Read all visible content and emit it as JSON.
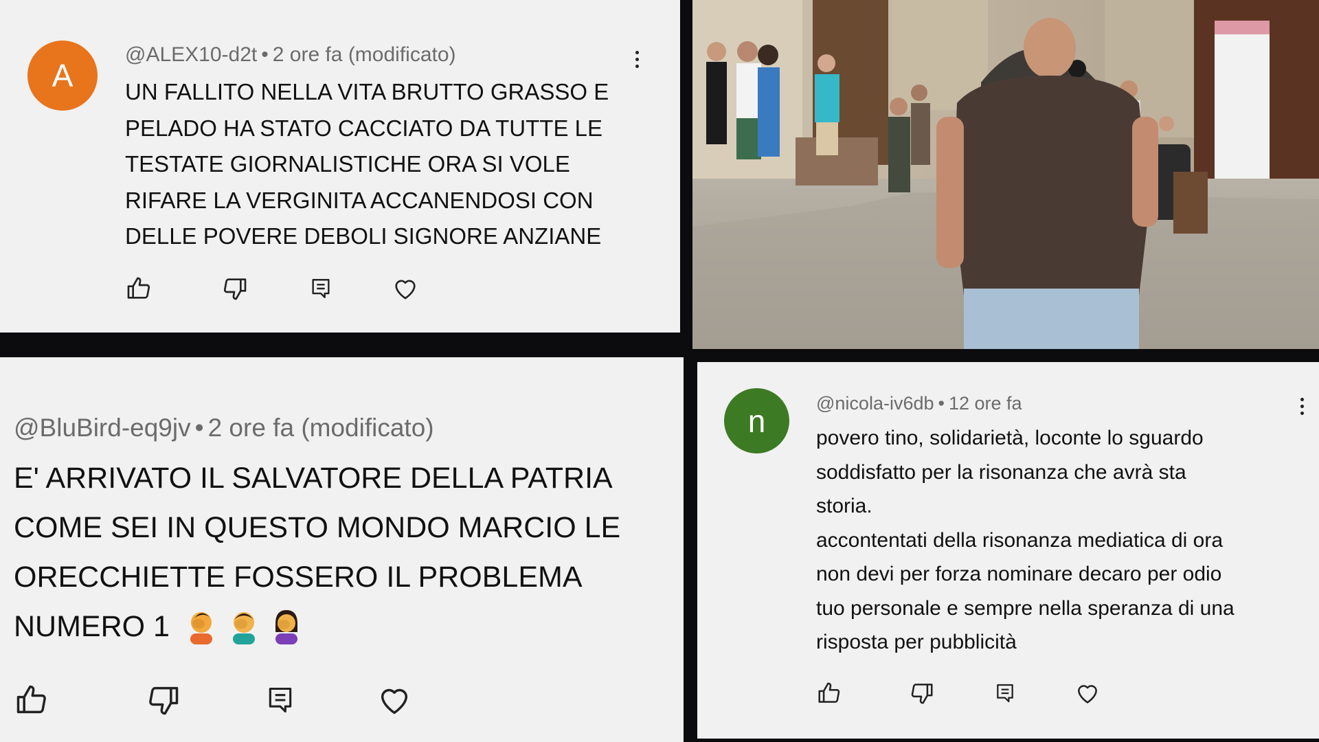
{
  "comments": [
    {
      "avatar_letter": "A",
      "avatar_color": "#e8741c",
      "handle": "@ALEX10-d2t",
      "separator": "•",
      "time": "2 ore fa (modificato)",
      "lines": [
        "UN FALLITO NELLA VITA BRUTTO GRASSO E",
        "PELADO HA STATO CACCIATO DA TUTTE LE",
        "TESTATE GIORNALISTICHE ORA SI VOLE",
        "RIFARE LA VERGINITA ACCANENDOSI CON",
        "DELLE POVERE DEBOLI SIGNORE ANZIANE"
      ]
    },
    {
      "handle": "@BluBird-eq9jv",
      "separator": "•",
      "time": "2 ore fa (modificato)",
      "lines": [
        "E' ARRIVATO IL SALVATORE DELLA PATRIA",
        "COME SEI IN QUESTO MONDO MARCIO  LE",
        "ORECCHIETTE FOSSERO IL PROBLEMA",
        "NUMERO 1"
      ],
      "emojis": [
        "facepalm-emoji",
        "facepalm-emoji",
        "facepalm-emoji"
      ]
    },
    {
      "avatar_letter": "n",
      "avatar_color": "#3d7a24",
      "handle": "@nicola-iv6db",
      "separator": "•",
      "time": "12 ore fa",
      "lines": [
        "povero tino, solidarietà, loconte lo sguardo",
        "soddisfatto per la risonanza che avrà sta",
        "storia.",
        "accontentati della risonanza mediatica di ora",
        "non devi per forza nominare decaro per odio",
        "tuo personale e sempre nella speranza di una",
        "risposta per pubblicità"
      ]
    }
  ],
  "icons": [
    "thumbs-up-icon",
    "thumbs-down-icon",
    "reply-icon",
    "heart-icon",
    "more-vert-icon"
  ],
  "colors": {
    "panel_bg": "#f1f1f1",
    "frame_bg": "#0c0c0e",
    "meta_text": "#6b6b6b"
  }
}
